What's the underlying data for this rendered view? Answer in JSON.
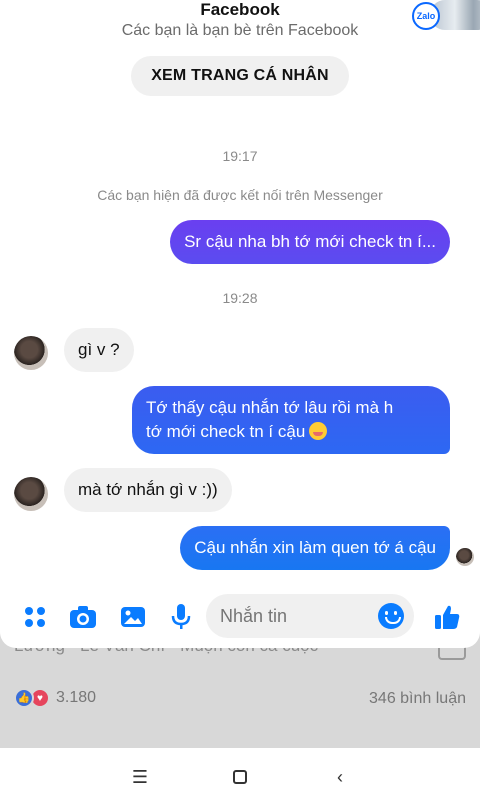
{
  "header": {
    "name": "Facebook",
    "subtitle": "Các bạn là bạn bè trên Facebook",
    "profile_button": "XEM TRANG CÁ NHÂN"
  },
  "zalo": {
    "label": "Zalo"
  },
  "conversation": {
    "timestamp_1": "19:17",
    "system_note": "Các bạn hiện đã được kết nối trên Messenger",
    "timestamp_2": "19:28",
    "messages": [
      {
        "side": "out",
        "text": "Sr cậu nha bh tớ mới check tn í..."
      },
      {
        "side": "in",
        "text": "gì v ?"
      },
      {
        "side": "out",
        "line1": "Tớ thấy cậu nhắn tớ lâu rồi mà h",
        "line2": "tớ mới check tn í cậu"
      },
      {
        "side": "in",
        "text": "mà tớ nhắn gì v :))"
      },
      {
        "side": "out",
        "text": "Cậu nhắn xin làm quen tớ á cậu"
      }
    ]
  },
  "composer": {
    "placeholder": "Nhắn tin",
    "icons": [
      "apps-icon",
      "camera-icon",
      "image-icon",
      "microphone-icon",
      "emoji-icon",
      "like-icon"
    ]
  },
  "background_post": {
    "title": "Lương · Lê Văn Chí · Muộn còn cả cuộc",
    "reaction_count": "3.180",
    "comment_count": "346 bình luận"
  },
  "navbar": {
    "recent_label": "☰",
    "back_label": "‹"
  },
  "colors": {
    "accent": "#0a7cff",
    "bubble_gradient_top": "#7b3ff2",
    "bubble_gradient_bottom": "#1877f2"
  }
}
